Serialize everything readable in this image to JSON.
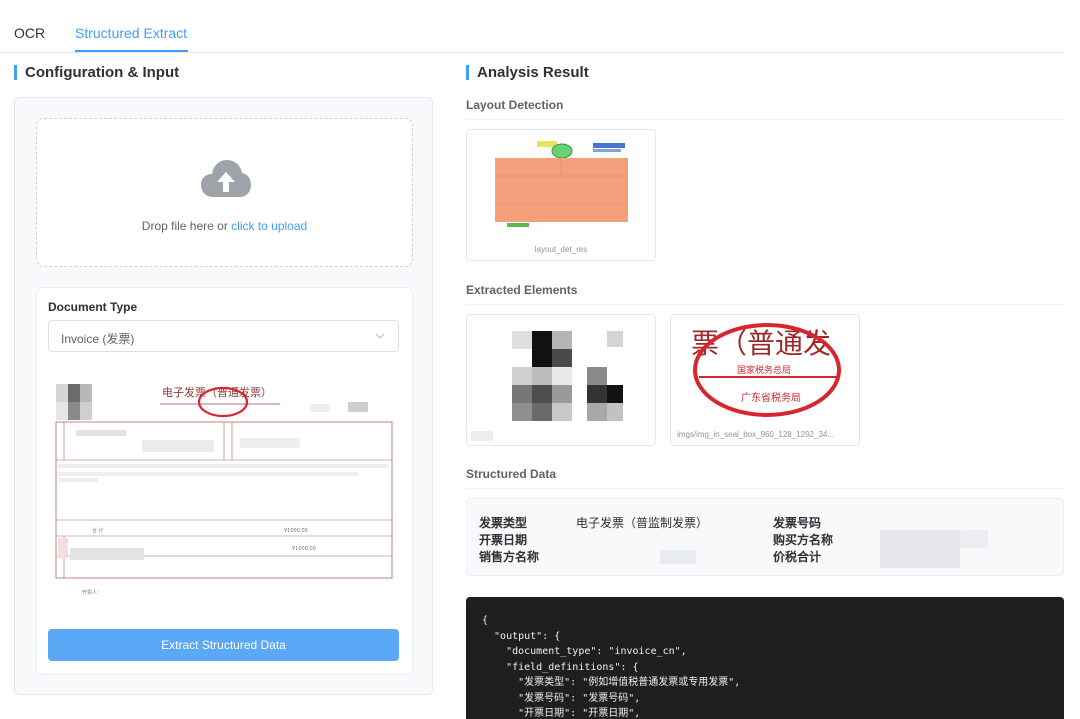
{
  "tabs": [
    {
      "label": "OCR",
      "active": false
    },
    {
      "label": "Structured Extract",
      "active": true
    }
  ],
  "left": {
    "title": "Configuration & Input",
    "upload": {
      "text": "Drop file here or ",
      "link": "click to upload",
      "icon": "cloud-upload-icon"
    },
    "document_type": {
      "label": "Document Type",
      "selected": "Invoice (发票)"
    },
    "preview": {
      "title": "电子发票（普通发票）",
      "payee": "开票人：",
      "amount_small": "¥1000.00"
    },
    "extract_button": "Extract Structured Data"
  },
  "right": {
    "title": "Analysis Result",
    "layout_detection": {
      "label": "Layout Detection",
      "caption": "layout_det_res"
    },
    "extracted_elements": {
      "label": "Extracted Elements",
      "items": [
        {
          "caption": ""
        },
        {
          "caption": "imgs/img_in_seal_box_960_128_1292_34...",
          "seal_text_top": "票（普通发",
          "seal_text_mid": "国家税务总局",
          "seal_text_bottom": "广东省税务局"
        }
      ]
    },
    "structured_data": {
      "label": "Structured Data",
      "fields": [
        {
          "key": "发票类型",
          "value": "电子发票（普监制发票）"
        },
        {
          "key": "发票号码",
          "value": ""
        },
        {
          "key": "开票日期",
          "value": ""
        },
        {
          "key": "购买方名称",
          "value": ""
        },
        {
          "key": "销售方名称",
          "value": ""
        },
        {
          "key": "价税合计",
          "value": ""
        }
      ]
    },
    "code_lines": [
      "{",
      "  \"output\": {",
      "    \"document_type\": \"invoice_cn\",",
      "    \"field_definitions\": {",
      "      \"发票类型\": \"例如增值税普通发票或专用发票\",",
      "      \"发票号码\": \"发票号码\",",
      "      \"开票日期\": \"开票日期\","
    ]
  },
  "colors": {
    "accent": "#409eff",
    "button": "#5aa8f6",
    "code_bg": "#1f1f1f",
    "layout_box": "#f4a07c",
    "seal_red": "#d7262e"
  }
}
